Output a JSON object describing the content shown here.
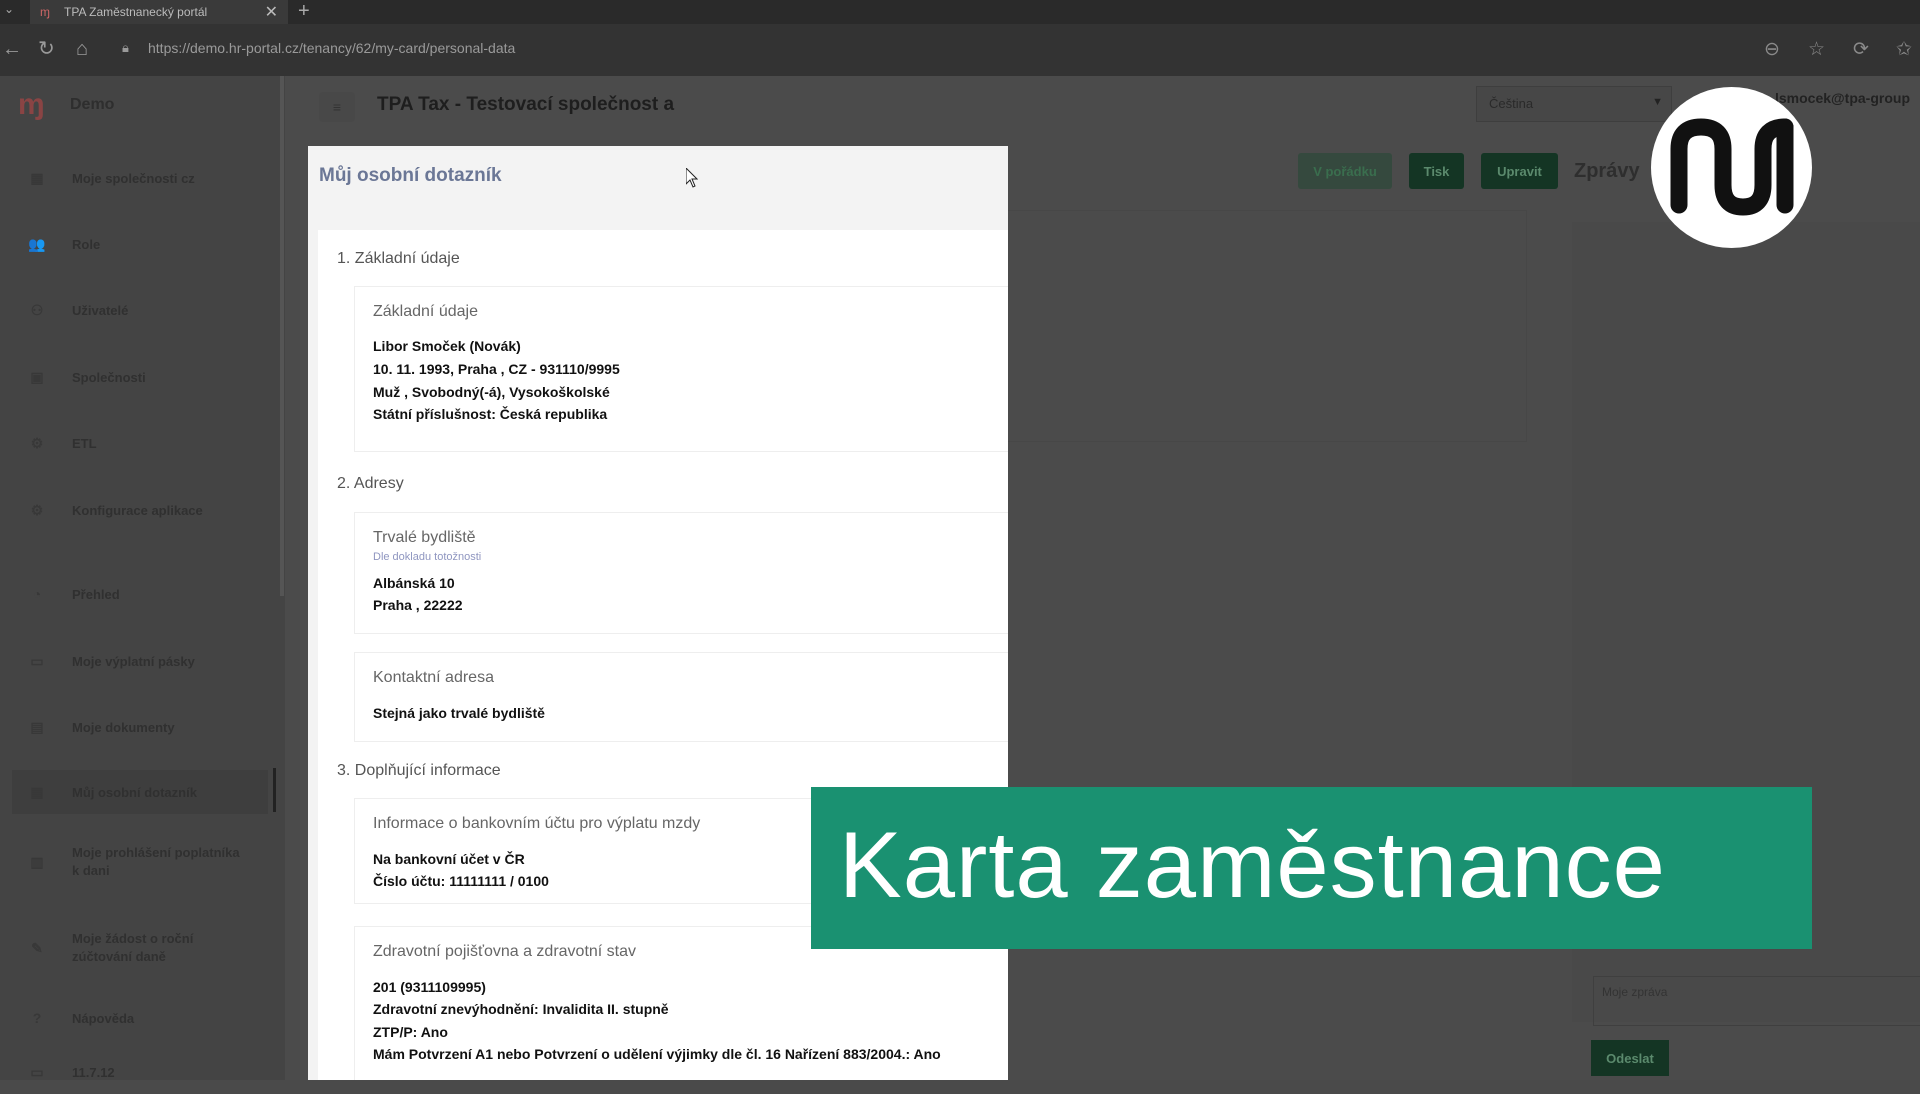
{
  "browser": {
    "tab_title": "TPA Zaměstnanecký portál",
    "tab_close": "✕",
    "new_tab": "+",
    "url": "https://demo.hr-portal.cz/tenancy/62/my-card/personal-data"
  },
  "sidebar": {
    "logo_glyph": "ɱ",
    "brand": "Demo",
    "items": [
      {
        "label": "Moje společnosti cz",
        "icon": "building-icon",
        "glyph": "▦"
      },
      {
        "label": "Role",
        "icon": "users-icon",
        "glyph": "👥"
      },
      {
        "label": "Uživatelé",
        "icon": "user-group-icon",
        "glyph": "⚇"
      },
      {
        "label": "Společnosti",
        "icon": "company-icon",
        "glyph": "▣"
      },
      {
        "label": "ETL",
        "icon": "gear-icon",
        "glyph": "⚙"
      },
      {
        "label": "Konfigurace aplikace",
        "icon": "settings-icon",
        "glyph": "⚙"
      },
      {
        "label": "Přehled",
        "icon": "dashboard-icon",
        "glyph": "◔"
      },
      {
        "label": "Moje výplatní pásky",
        "icon": "payslip-icon",
        "glyph": "▭"
      },
      {
        "label": "Moje dokumenty",
        "icon": "document-icon",
        "glyph": "▤"
      },
      {
        "label": "Můj osobní dotazník",
        "icon": "questionnaire-icon",
        "glyph": "▦"
      },
      {
        "label1": "Moje prohlášení poplatníka",
        "label2": "k dani",
        "icon": "declaration-icon",
        "glyph": "▥"
      },
      {
        "label1": "Moje žádost o roční",
        "label2": "zúčtování daně",
        "icon": "request-icon",
        "glyph": "✎"
      },
      {
        "label": "Nápověda",
        "icon": "help-icon",
        "glyph": "?"
      },
      {
        "label": "11.7.12",
        "icon": "version-icon",
        "glyph": "▭"
      }
    ]
  },
  "topbar": {
    "hamburger": "≡",
    "company": "TPA Tax - Testovací společnost a",
    "language": "Čeština",
    "user_email": "lsmocek@tpa-group"
  },
  "actions": {
    "ok": "V pořádku",
    "print": "Tisk",
    "edit": "Upravit"
  },
  "messages": {
    "title": "Zprávy",
    "input_placeholder": "Moje zpráva",
    "send": "Odeslat"
  },
  "modal": {
    "title": "Můj osobní dotazník",
    "sections": [
      {
        "heading": "1. Základní údaje"
      },
      {
        "heading": "2. Adresy"
      },
      {
        "heading": "3. Doplňující informace"
      }
    ],
    "basic": {
      "heading": "Základní údaje",
      "lines": [
        "Libor Smoček (Novák)",
        "10. 11. 1993, Praha , CZ - 931110/9995",
        "Muž , Svobodný(-á), Vysokoškolské",
        "Státní příslušnost: Česká republika"
      ]
    },
    "permanent": {
      "heading": "Trvalé bydliště",
      "sub": "Dle dokladu totožnosti",
      "lines": [
        "Albánská 10",
        "Praha , 22222"
      ]
    },
    "contact": {
      "heading": "Kontaktní adresa",
      "lines": [
        "Stejná jako trvalé bydliště"
      ]
    },
    "bank": {
      "heading": "Informace o bankovním účtu pro výplatu mzdy",
      "lines": [
        "Na bankovní účet v ČR",
        "Číslo účtu: 11111111 / 0100"
      ]
    },
    "health": {
      "heading": "Zdravotní pojišťovna a zdravotní stav",
      "lines": [
        "201 (9311109995)",
        "Zdravotní znevýhodnění: Invalidita II. stupně",
        "ZTP/P: Ano",
        "Mám Potvrzení A1 nebo Potvrzení o udělení výjimky dle čl. 16 Nařízení 883/2004.: Ano"
      ]
    }
  },
  "banner": {
    "text": "Karta zaměstnance"
  },
  "colors": {
    "banner": "#1a9171",
    "primary_button": "#143524",
    "modal_title": "#6b7796"
  }
}
